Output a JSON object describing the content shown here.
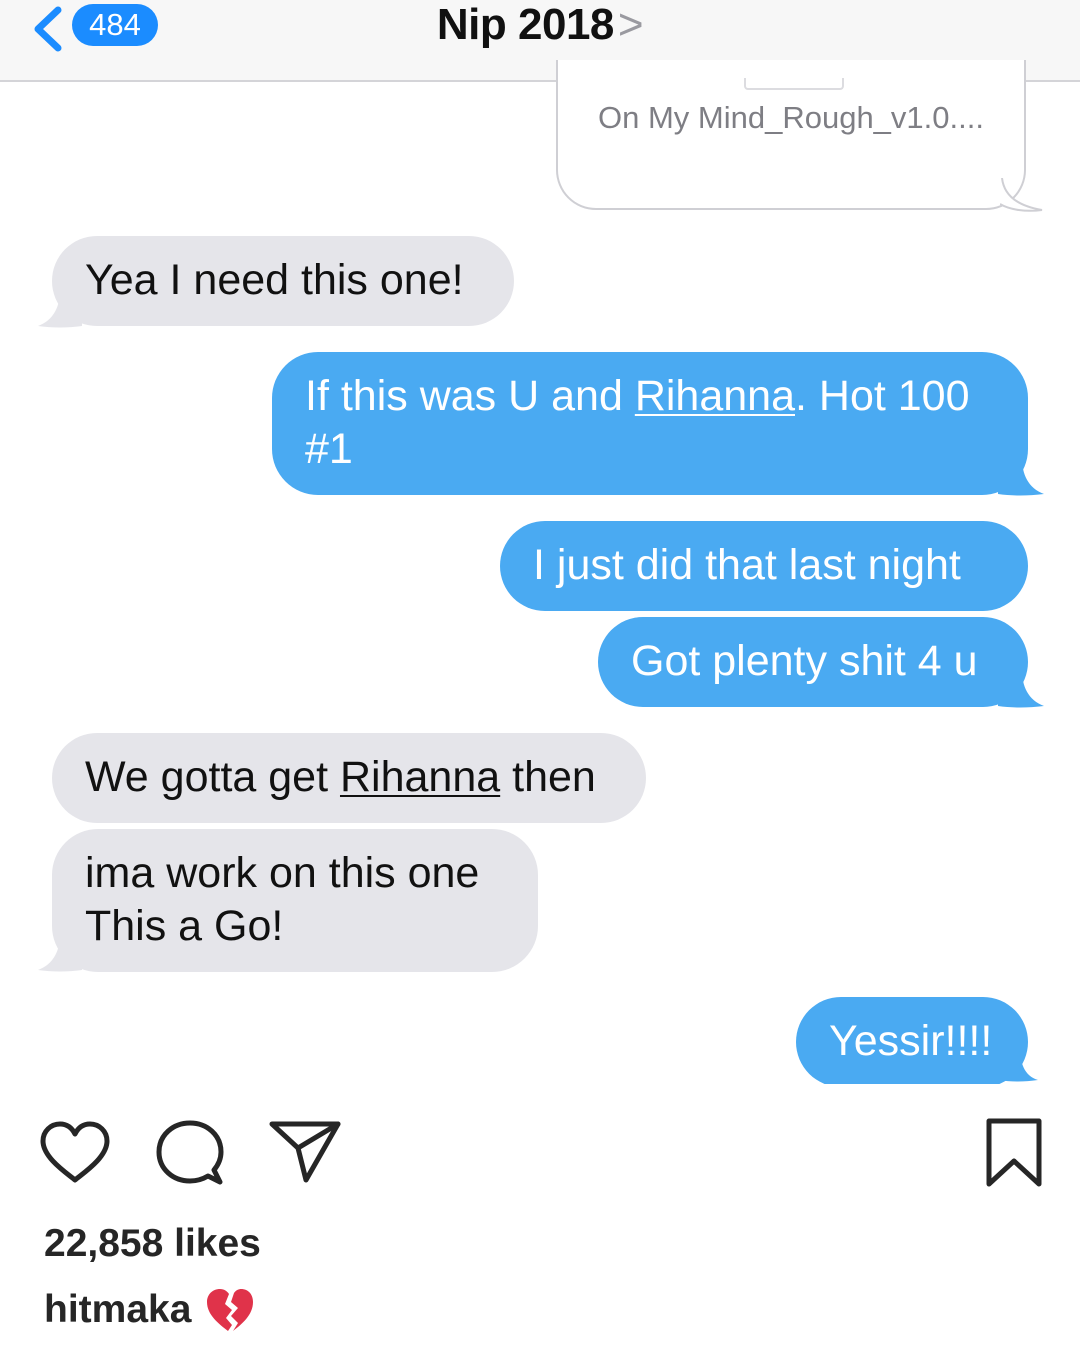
{
  "header": {
    "unread_count": "484",
    "contact_name": "Nip 2018",
    "chevron": ">"
  },
  "attachment": {
    "filename": "On My Mind_Rough_v1.0...."
  },
  "messages": [
    {
      "direction": "incoming",
      "pre": "Yea I need this one!",
      "link": "",
      "post": ""
    },
    {
      "direction": "outgoing",
      "pre": "If this was U and ",
      "link": "Rihanna",
      "post": ". Hot 100",
      "line2": "#1"
    },
    {
      "direction": "outgoing",
      "pre": "I just did that last night",
      "link": "",
      "post": ""
    },
    {
      "direction": "outgoing",
      "pre": "Got plenty shit 4 u",
      "link": "",
      "post": ""
    },
    {
      "direction": "incoming",
      "pre": "We gotta get ",
      "link": "Rihanna",
      "post": " then"
    },
    {
      "direction": "incoming",
      "pre": "ima work on this one",
      "link": "",
      "post": "",
      "line2": "This a Go!"
    },
    {
      "direction": "outgoing",
      "pre": "Yessir!!!!",
      "link": "",
      "post": ""
    }
  ],
  "instagram": {
    "likes": "22,858 likes",
    "username": "hitmaka",
    "icons": [
      "heart-icon",
      "comment-icon",
      "share-icon",
      "bookmark-icon",
      "broken-heart-emoji"
    ]
  },
  "colors": {
    "outgoing_bubble": "#4aaaf2",
    "incoming_bubble": "#e5e5ea",
    "badge": "#1b8cff",
    "broken_heart": "#e0334a"
  }
}
